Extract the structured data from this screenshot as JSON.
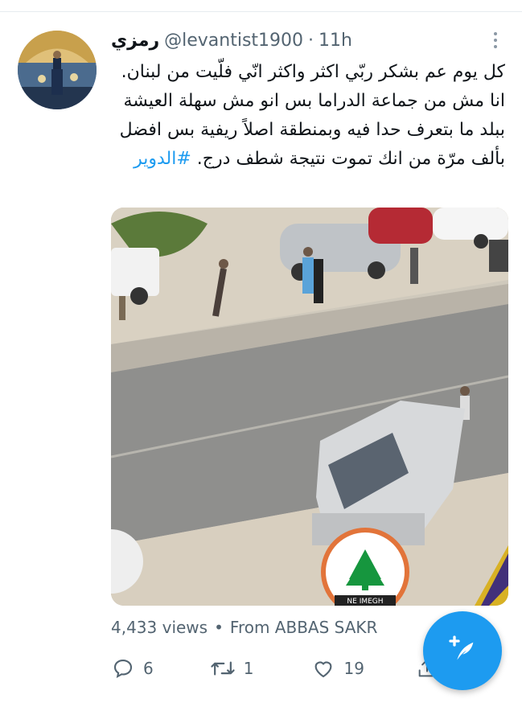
{
  "tweet": {
    "display_name": "رمزي",
    "handle": "@levantist1900",
    "separator": "·",
    "time": "11h",
    "text": "كل يوم عم بشكر ربّي اكثر واكثر انّي فلّيت من لبنان. انا مش من جماعة الدراما بس انو مش سهلة العيشة ببلد ما بتعرف حدا فيه وبمنطقة اصلاً ريفية بس افضل بألف مرّة من انك تموت نتيجة شطف درج.",
    "hashtag": "#الدوير",
    "media_logo_text": "NE IMEGH"
  },
  "stats": {
    "views": "4,433 views",
    "dot": "•",
    "source": "From ABBAS SAKR"
  },
  "actions": {
    "replies": "6",
    "retweets": "1",
    "likes": "19"
  },
  "colors": {
    "accent": "#1d9bf0",
    "muted": "#536471",
    "text": "#0f1419"
  },
  "icons": [
    "more-vertical-icon",
    "reply-icon",
    "retweet-icon",
    "like-icon",
    "share-icon",
    "compose-tweet-icon"
  ]
}
